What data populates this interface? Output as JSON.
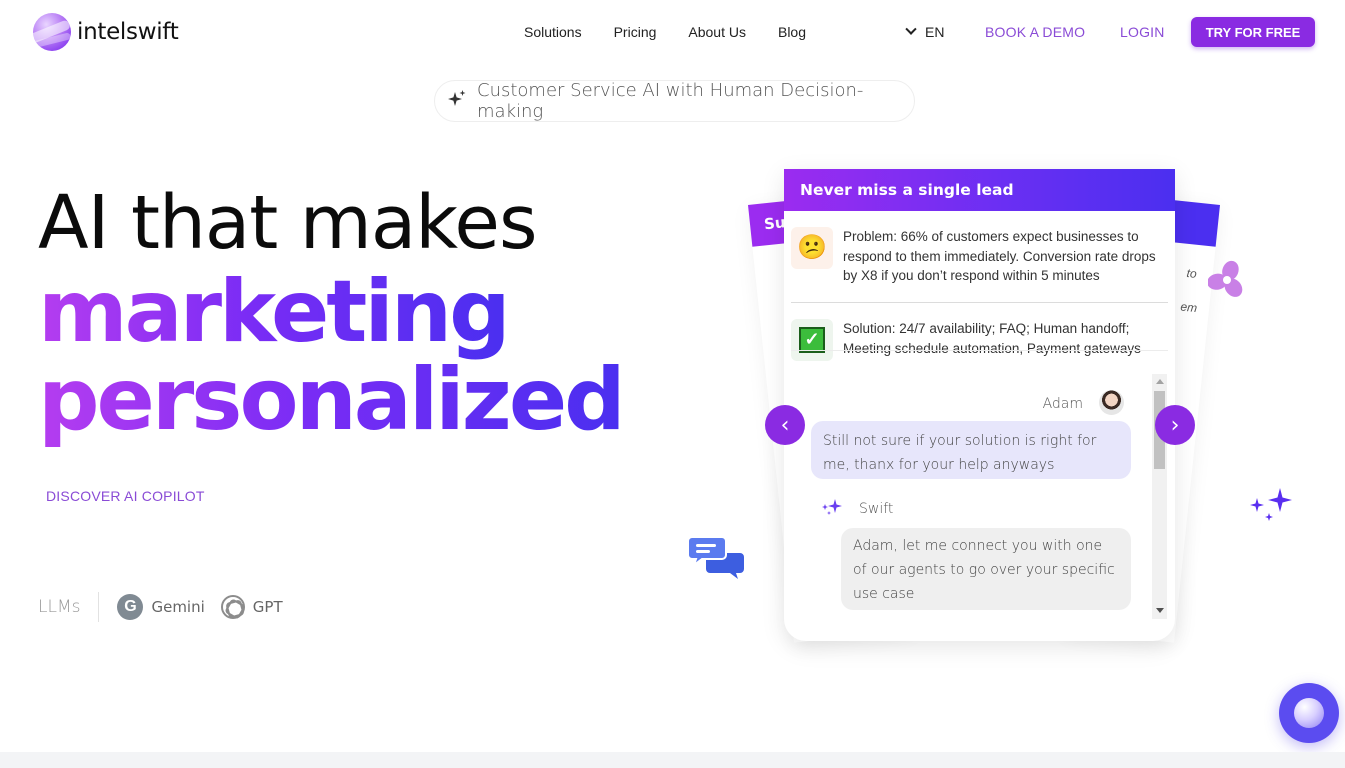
{
  "brand": {
    "name": "intelswift",
    "accent": "#8a2be2",
    "link_color": "#8a4bd6"
  },
  "nav": {
    "links": [
      "Solutions",
      "Pricing",
      "About Us",
      "Blog"
    ],
    "language": "EN",
    "book_demo": "BOOK A DEMO",
    "login": "LOGIN",
    "cta": "TRY FOR FREE"
  },
  "tagline": {
    "icon": "sparkles-icon",
    "text": "Customer Service AI with Human Decision-making"
  },
  "hero": {
    "line1": "AI that makes",
    "line2": "marketing",
    "line3": "personalized",
    "discover_link": "DISCOVER AI COPILOT"
  },
  "llms": {
    "label": "LLMs",
    "items": [
      {
        "name": "Gemini",
        "icon": "google-g-icon",
        "glyph": "G"
      },
      {
        "name": "GPT",
        "icon": "openai-icon"
      }
    ]
  },
  "carousel": {
    "back_left_title": "Sup",
    "back_right_snippets": [
      "to",
      "em"
    ],
    "card": {
      "title": "Never miss a single lead",
      "problem": {
        "icon": "confused-face-icon",
        "emoji": "😕",
        "text": "Problem: 66% of customers expect businesses to respond to them immediately. Conversion rate drops by X8 if you don’t respond within 5 minutes"
      },
      "solution": {
        "icon": "check-mark-icon",
        "glyph": "✓",
        "text": "Solution: 24/7 availability; FAQ; Human handoff; Meeting schedule automation, Payment gateways"
      },
      "chat": {
        "user_name": "Adam",
        "user_message": "Still not sure if your solution is right for me, thanx for your help anyways",
        "bot_name": "Swift",
        "bot_icon": "✦",
        "bot_message": "Adam, let me connect you with one of our agents to go over your specific use case"
      }
    },
    "prev_glyph": "‹",
    "next_glyph": "›"
  }
}
